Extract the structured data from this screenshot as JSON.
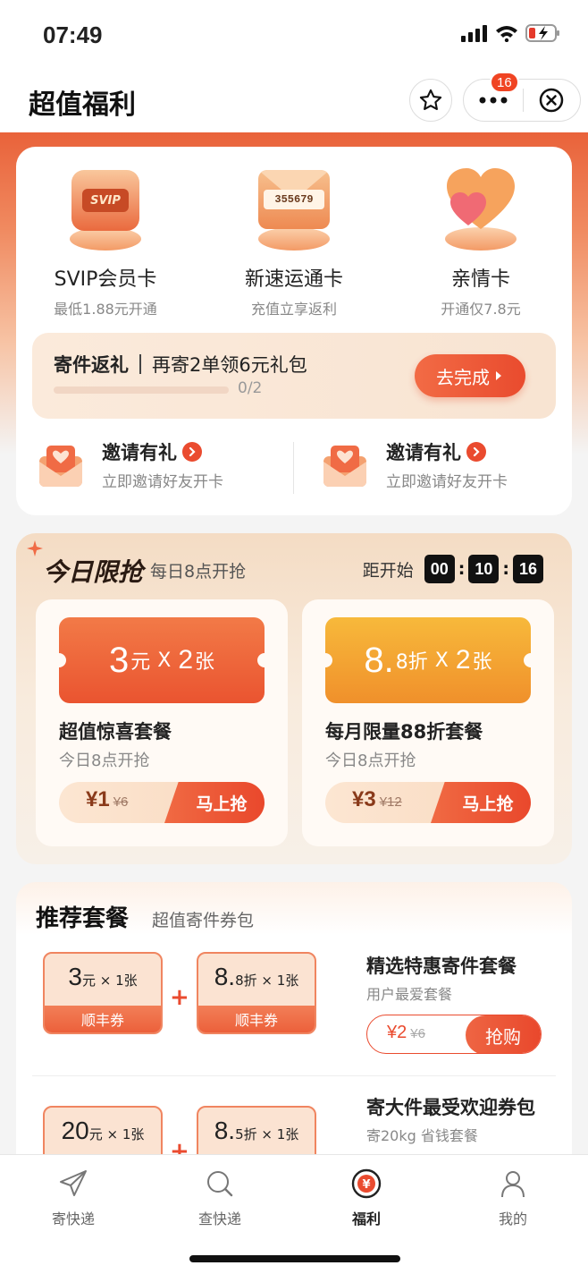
{
  "status_bar": {
    "time": "07:49"
  },
  "nav": {
    "title": "超值福利",
    "badge_count": "16"
  },
  "colors": {
    "accent": "#ea4b2f",
    "gold": "#f0902b",
    "dark": "#222222"
  },
  "cards": [
    {
      "name": "SVIP会员卡",
      "sub": "最低1.88元开通",
      "icon": "svip-card-icon",
      "icon_text": "SVIP"
    },
    {
      "name": "新速运通卡",
      "sub": "充值立享返利",
      "icon": "envelope-card-icon",
      "icon_text": "355679"
    },
    {
      "name": "亲情卡",
      "sub": "开通仅7.8元",
      "icon": "heart-icon"
    }
  ],
  "task": {
    "title": "寄件返礼",
    "desc": "再寄2单领6元礼包",
    "progress": "0/2",
    "progress_fraction": 0,
    "button": "去完成"
  },
  "invites": [
    {
      "title": "邀请有礼",
      "sub": "立即邀请好友开卡"
    },
    {
      "title": "邀请有礼",
      "sub": "立即邀请好友开卡"
    }
  ],
  "flash": {
    "logo": "今日限抢",
    "sub": "每日8点开抢",
    "countdown_label": "距开始",
    "h": "00",
    "m": "10",
    "s": "16",
    "deals": [
      {
        "coupon_big": "3",
        "coupon_unit": "元",
        "coupon_x": "X",
        "coupon_count": "2",
        "coupon_count_unit": "张",
        "name": "超值惊喜套餐",
        "sub": "今日8点开抢",
        "price": "¥1",
        "orig": "¥6",
        "action": "马上抢"
      },
      {
        "coupon_big": "8.",
        "coupon_unit": "8折",
        "coupon_x": "X",
        "coupon_count": "2",
        "coupon_count_unit": "张",
        "name": "每月限量88折套餐",
        "sub": "今日8点开抢",
        "price": "¥3",
        "orig": "¥12",
        "action": "马上抢"
      }
    ]
  },
  "recommend": {
    "title": "推荐套餐",
    "sub": "超值寄件券包",
    "packages": [
      {
        "name": "精选特惠寄件套餐",
        "sub": "用户最爱套餐",
        "price": "¥2",
        "orig": "¥6",
        "action": "抢购",
        "coupons": [
          {
            "n": "3",
            "unit": "元",
            "times": "× 1",
            "cnt": "张",
            "foot": "顺丰券"
          },
          {
            "n": "8.",
            "unit": "8折",
            "times": "× 1",
            "cnt": "张",
            "foot": "顺丰券"
          }
        ]
      },
      {
        "name": "寄大件最受欢迎券包",
        "sub": "寄20kg 省钱套餐",
        "coupons": [
          {
            "n": "20",
            "unit": "元",
            "times": "× 1",
            "cnt": "张"
          },
          {
            "n": "8.",
            "unit": "5折",
            "times": "× 1",
            "cnt": "张"
          }
        ]
      }
    ]
  },
  "tabs": [
    {
      "label": "寄快递",
      "icon": "send-icon"
    },
    {
      "label": "查快递",
      "icon": "search-icon"
    },
    {
      "label": "福利",
      "icon": "yen-icon",
      "active": true
    },
    {
      "label": "我的",
      "icon": "user-icon"
    }
  ]
}
